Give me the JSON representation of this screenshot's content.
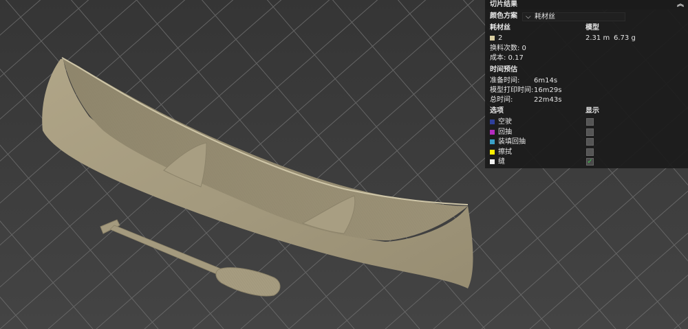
{
  "panel": {
    "title": "切片结果",
    "color_scheme_label": "颜色方案",
    "color_scheme_value": "耗材丝",
    "col_filament": "耗材丝",
    "col_model": "模型",
    "filament": {
      "id": "2",
      "color": "#d8cca0",
      "length": "2.31 m",
      "weight": "6.73 g"
    },
    "swaps": "换料次数: 0",
    "cost": "成本: 0.17",
    "time_header": "时间预估",
    "prep_label": "准备时间:",
    "prep_value": "6m14s",
    "print_label": "模型打印时间:",
    "print_value": "16m29s",
    "total_label": "总时间:",
    "total_value": "22m43s",
    "options_header": "选项",
    "display_header": "显示",
    "options": [
      {
        "label": "空驶",
        "color": "#2e3f9a",
        "checked": false
      },
      {
        "label": "回抽",
        "color": "#b52bbf",
        "checked": false
      },
      {
        "label": "装填回抽",
        "color": "#3aa0c7",
        "checked": false
      },
      {
        "label": "擦拭",
        "color": "#ffee00",
        "checked": false
      },
      {
        "label": "缝",
        "color": "#f2f2f2",
        "checked": true
      }
    ]
  }
}
